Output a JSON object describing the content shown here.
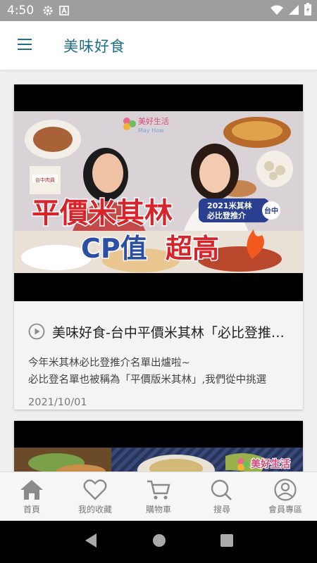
{
  "status_bar": {
    "time": "4:50"
  },
  "app_bar": {
    "title": "美味好食"
  },
  "cards": [
    {
      "title": "美味好食-台中平價米其林「必比登推介」",
      "desc_line1": "今年米其林必比登推介名單出爐啦~",
      "desc_line2": "必比登名單也被稱為「平價版米其林」,我們從中挑選",
      "date": "2021/10/01",
      "thumb": {
        "brand": "美好生活",
        "brand_en": "May How",
        "headline1": "平價米其林",
        "headline2a": "CP值",
        "headline2b": "超高",
        "badge1": "2021米其林",
        "badge2": "必比登推介",
        "badge_city": "台中"
      }
    },
    {
      "thumb": {
        "brand": "美好生活"
      }
    }
  ],
  "bottom_nav": [
    {
      "label": "首頁",
      "icon": "home-icon"
    },
    {
      "label": "我的收藏",
      "icon": "heart-icon"
    },
    {
      "label": "購物車",
      "icon": "cart-icon"
    },
    {
      "label": "搜尋",
      "icon": "search-icon"
    },
    {
      "label": "會員專區",
      "icon": "user-icon"
    }
  ],
  "colors": {
    "accent": "#1f6e87",
    "status_bar": "#9e9e9e"
  }
}
